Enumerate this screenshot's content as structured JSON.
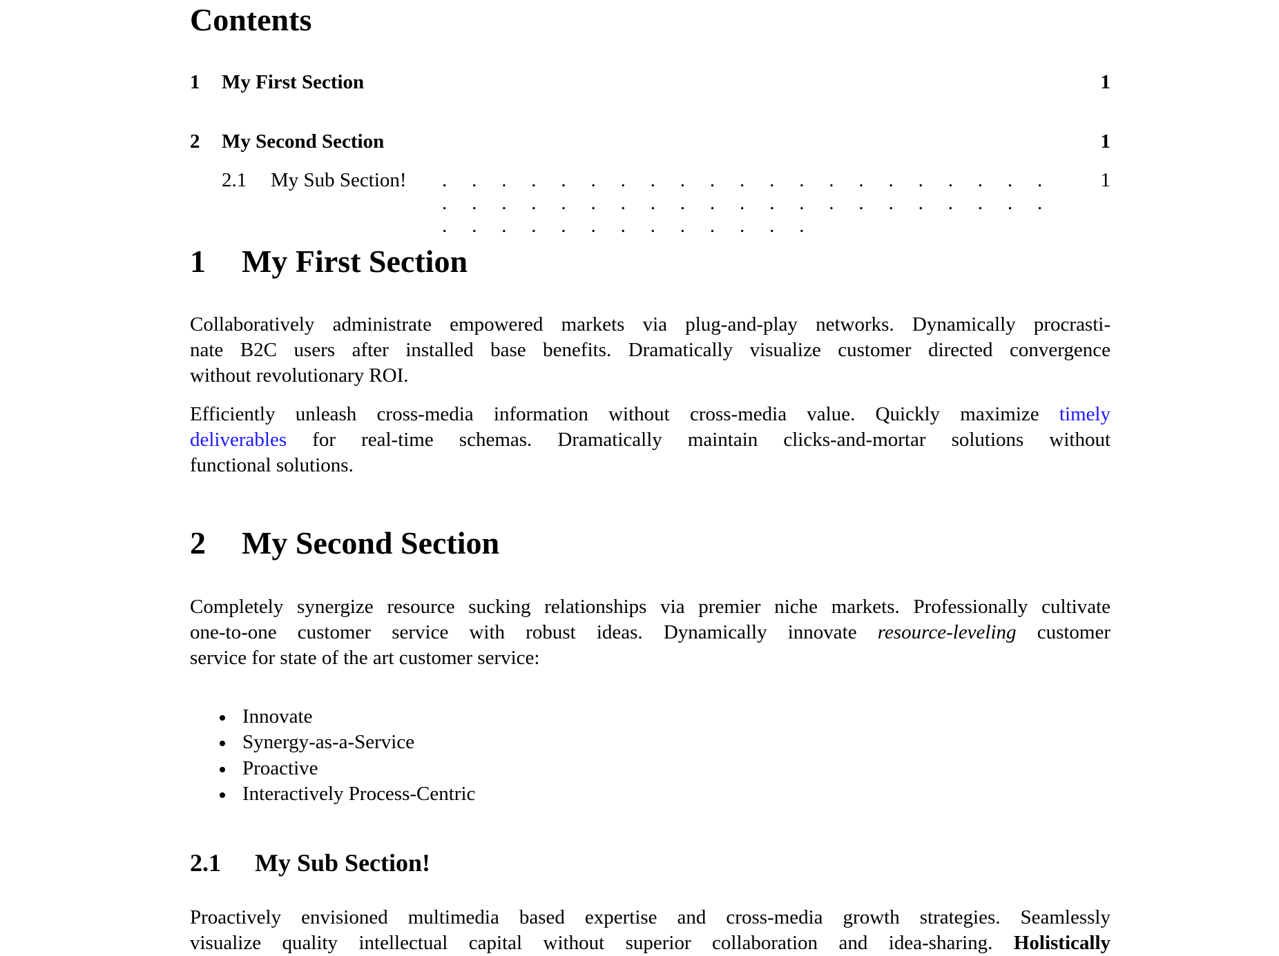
{
  "toc": {
    "title": "Contents",
    "entries": [
      {
        "num": "1",
        "label": "My First Section",
        "page": "1"
      },
      {
        "num": "2",
        "label": "My Second Section",
        "page": "1"
      },
      {
        "num": "2.1",
        "label": "My Sub Section!",
        "page": "1",
        "leader": ". . . . . . . . . . . . . . . . . . . . . . . . . . . . . . . . . . . . . . . . . . . . . . . . . . . . . . ."
      }
    ]
  },
  "section1": {
    "num": "1",
    "title": "My First Section",
    "para1": [
      "Collaboratively administrate empowered markets via plug-and-play networks. Dynamically procrasti-",
      "nate B2C users after installed base benefits. Dramatically visualize customer directed convergence",
      "without revolutionary ROI."
    ],
    "para2": {
      "line1_text": "Efficiently unleash cross-media information without cross-media value. Quickly maximize",
      "line1_link": "timely",
      "line2_link": "deliverables",
      "line2_text": "for real-time schemas. Dramatically maintain clicks-and-mortar solutions without",
      "line3": "functional solutions."
    }
  },
  "section2": {
    "num": "2",
    "title": "My Second Section",
    "para": {
      "line1": "Completely synergize resource sucking relationships via premier niche markets. Professionally cultivate",
      "line2_pre": "one-to-one customer service with robust ideas. Dynamically innovate",
      "line2_em": "resource-leveling",
      "line2_post": "customer",
      "line3": "service for state of the art customer service:"
    },
    "bullets": [
      "Innovate",
      "Synergy-as-a-Service",
      "Proactive",
      "Interactively Process-Centric"
    ]
  },
  "subsection21": {
    "num": "2.1",
    "title": "My Sub Section!",
    "para": {
      "line1": "Proactively envisioned multimedia based expertise and cross-media growth strategies. Seamlessly",
      "line2_pre": "visualize quality intellectual capital without superior collaboration and idea-sharing.",
      "line2_bold": "Holistically"
    }
  },
  "colors": {
    "link": "#1a1aff",
    "text": "#000000",
    "background": "#ffffff"
  }
}
